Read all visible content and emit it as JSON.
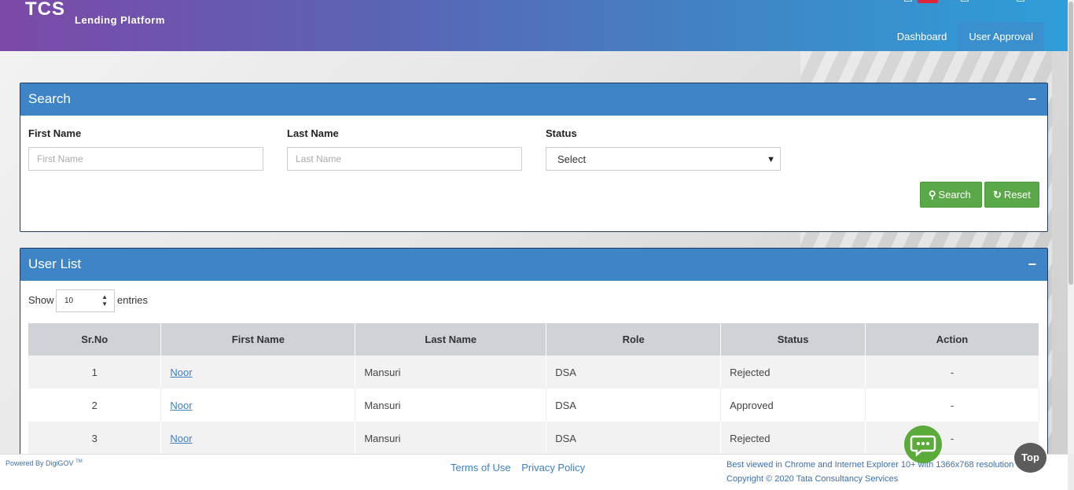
{
  "header": {
    "logo_main": "TCS",
    "logo_sub": "Lending Platform",
    "nav": [
      "Dashboard",
      "User Approval"
    ]
  },
  "search": {
    "title": "Search",
    "collapse": "−",
    "fields": {
      "first_name": {
        "label": "First Name",
        "placeholder": "First Name"
      },
      "last_name": {
        "label": "Last Name",
        "placeholder": "Last Name"
      },
      "status": {
        "label": "Status",
        "value": "Select"
      }
    },
    "search_button": "Search",
    "reset_button": "Reset"
  },
  "user_list": {
    "title": "User List",
    "collapse": "−",
    "show_label": "Show",
    "show_value": "10",
    "entries_label": "entries",
    "columns": [
      "Sr.No",
      "First Name",
      "Last Name",
      "Role",
      "Status",
      "Action"
    ],
    "rows": [
      {
        "sr": "1",
        "first": "Noor",
        "last": "Mansuri",
        "role": "DSA",
        "status": "Rejected",
        "action": "-"
      },
      {
        "sr": "2",
        "first": "Noor",
        "last": "Mansuri",
        "role": "DSA",
        "status": "Approved",
        "action": "-"
      },
      {
        "sr": "3",
        "first": "Noor",
        "last": "Mansuri",
        "role": "DSA",
        "status": "Rejected",
        "action": "-"
      }
    ]
  },
  "footer": {
    "powered": "Powered By DigiGOV",
    "tm": "TM",
    "terms": "Terms of Use",
    "privacy": "Privacy Policy",
    "best_viewed": "Best viewed in Chrome and Internet Explorer 10+ with 1366x768 resolution",
    "copyright": "Copyright © 2020 Tata Consultancy Services"
  },
  "top_button": "Top",
  "colors": {
    "panel_head": "#3d85c6",
    "button_green": "#5aa848",
    "link": "#3d7fc2"
  }
}
